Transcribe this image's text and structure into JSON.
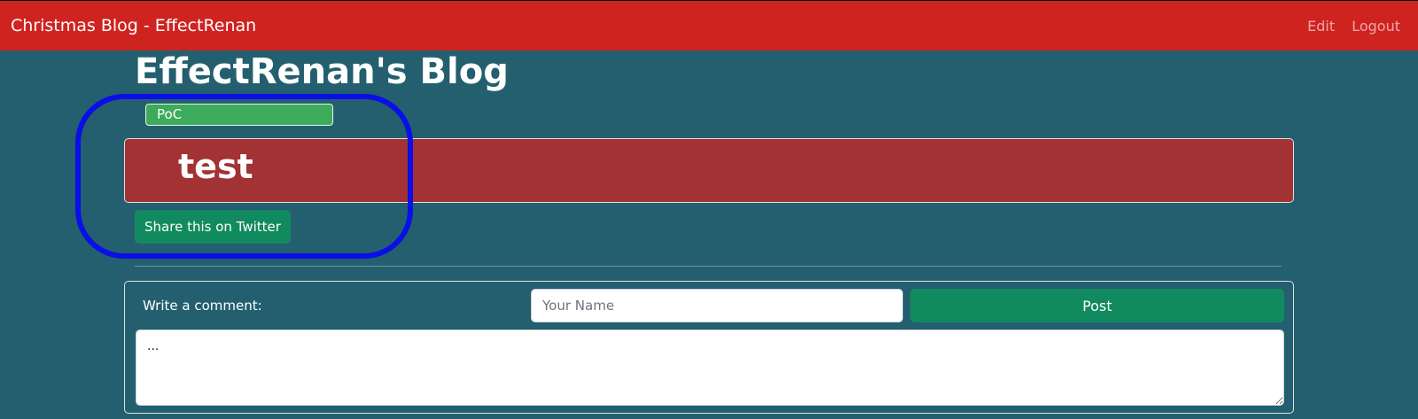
{
  "navbar": {
    "brand": "Christmas Blog - EffectRenan",
    "links": [
      "Edit",
      "Logout"
    ],
    "color": "#cf2320"
  },
  "blog": {
    "title": "EffectRenan's Blog"
  },
  "post": {
    "tag": "PoC",
    "title": "test",
    "share_label": "Share this on Twitter"
  },
  "comment_form": {
    "label": "Write a comment:",
    "name_placeholder": "Your Name",
    "post_label": "Post",
    "comment_value": "..."
  },
  "colors": {
    "background": "#235f6f",
    "post_background": "#a23233",
    "button": "#128a5f",
    "tag": "#3cab5b",
    "highlight": "#0a0ee8"
  }
}
